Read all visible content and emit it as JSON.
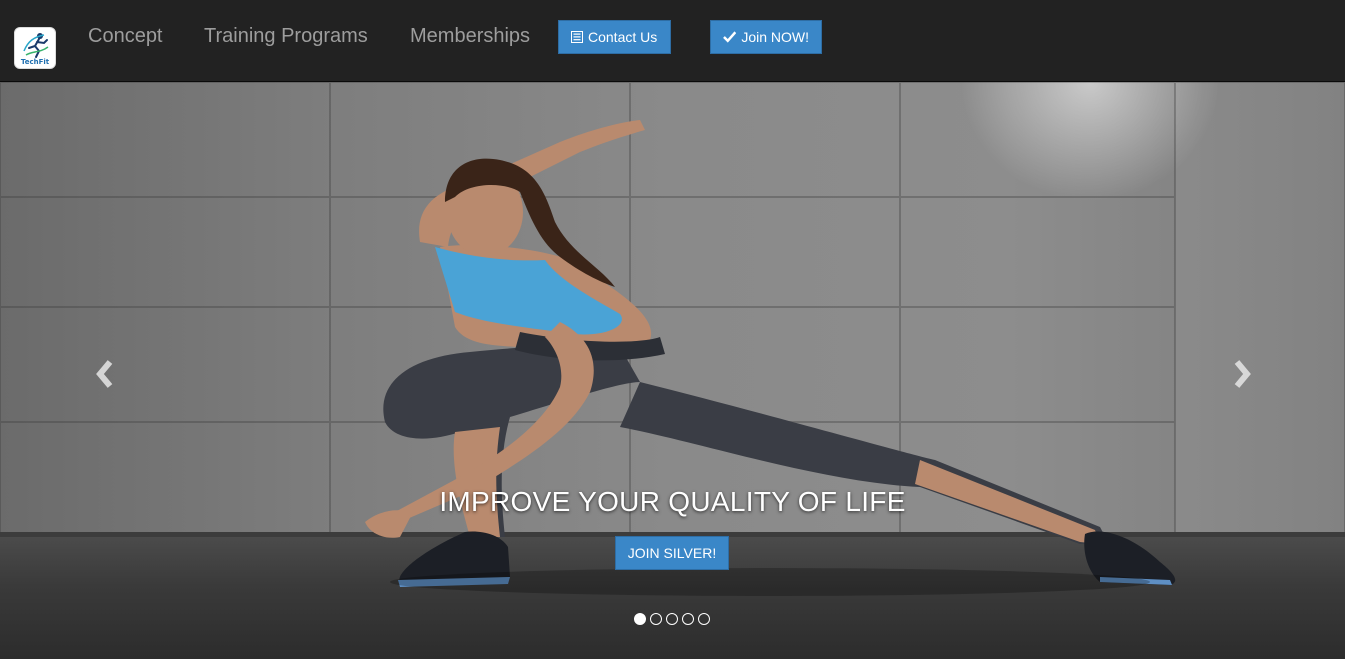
{
  "brand": {
    "logo_text": "TechFit",
    "icon": "runner-logo-icon"
  },
  "nav": {
    "links": [
      {
        "label": "Concept"
      },
      {
        "label": "Training Programs"
      },
      {
        "label": "Memberships"
      }
    ],
    "contact_button": {
      "label": "Contact Us",
      "icon": "list-alt-icon"
    },
    "join_button": {
      "label": "Join NOW!",
      "icon": "check-icon"
    }
  },
  "carousel": {
    "caption_title": "IMPROVE YOUR QUALITY OF LIFE",
    "cta_label": "JOIN SILVER!",
    "prev_icon": "chevron-left-icon",
    "next_icon": "chevron-right-icon",
    "slide_count": 5,
    "active_slide": 1,
    "hero_image": "athlete-lunge-stretch"
  },
  "colors": {
    "navbar_bg": "#222222",
    "nav_text": "#9d9d9d",
    "primary_button": "#3a87c8",
    "button_border": "#2e6da4"
  }
}
